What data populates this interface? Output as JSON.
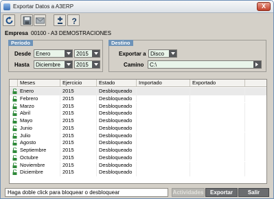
{
  "window": {
    "title": "Exportar Datos a A3ERP",
    "close_label": "X"
  },
  "toolbar": {
    "buttons": [
      {
        "name": "refresh-icon"
      },
      {
        "name": "save-icon"
      },
      {
        "name": "mail-icon"
      },
      {
        "name": "plus-minus-icon"
      },
      {
        "name": "help-icon"
      }
    ]
  },
  "empresa": {
    "label": "Empresa",
    "value": "00100 - A3 DEMOSTRACIONES"
  },
  "periodo": {
    "title": "Período",
    "desde_label": "Desde",
    "desde_month": "Enero",
    "desde_year": "2015",
    "hasta_label": "Hasta",
    "hasta_month": "Diciembre",
    "hasta_year": "2015"
  },
  "destino": {
    "title": "Destino",
    "exportar_label": "Exportar a",
    "exportar_value": "Disco",
    "camino_label": "Camino",
    "camino_value": "C:\\"
  },
  "grid": {
    "columns": [
      "Meses",
      "Ejercicio",
      "Estado",
      "Importado",
      "Exportado"
    ],
    "rows": [
      {
        "mes": "Enero",
        "ejercicio": "2015",
        "estado": "Desbloqueado",
        "importado": "",
        "exportado": ""
      },
      {
        "mes": "Febrero",
        "ejercicio": "2015",
        "estado": "Desbloqueado",
        "importado": "",
        "exportado": ""
      },
      {
        "mes": "Marzo",
        "ejercicio": "2015",
        "estado": "Desbloqueado",
        "importado": "",
        "exportado": ""
      },
      {
        "mes": "Abril",
        "ejercicio": "2015",
        "estado": "Desbloqueado",
        "importado": "",
        "exportado": ""
      },
      {
        "mes": "Mayo",
        "ejercicio": "2015",
        "estado": "Desbloqueado",
        "importado": "",
        "exportado": ""
      },
      {
        "mes": "Junio",
        "ejercicio": "2015",
        "estado": "Desbloqueado",
        "importado": "",
        "exportado": ""
      },
      {
        "mes": "Julio",
        "ejercicio": "2015",
        "estado": "Desbloqueado",
        "importado": "",
        "exportado": ""
      },
      {
        "mes": "Agosto",
        "ejercicio": "2015",
        "estado": "Desbloqueado",
        "importado": "",
        "exportado": ""
      },
      {
        "mes": "Septiembre",
        "ejercicio": "2015",
        "estado": "Desbloqueado",
        "importado": "",
        "exportado": ""
      },
      {
        "mes": "Octubre",
        "ejercicio": "2015",
        "estado": "Desbloqueado",
        "importado": "",
        "exportado": ""
      },
      {
        "mes": "Noviembre",
        "ejercicio": "2015",
        "estado": "Desbloqueado",
        "importado": "",
        "exportado": ""
      },
      {
        "mes": "Diciembre",
        "ejercicio": "2015",
        "estado": "Desbloqueado",
        "importado": "",
        "exportado": ""
      }
    ],
    "row_icon": "unlock-icon"
  },
  "footer": {
    "status_text": "Haga doble click para bloquear o desbloquear",
    "actividades_label": "Actividades",
    "exportar_label": "Exportar",
    "salir_label": "Salir"
  },
  "colors": {
    "group_header": "#6e93b8",
    "combo_bg": "#e9f5ea",
    "button_bg": "#6b6d70",
    "lock_icon": "#2f8a3a"
  }
}
